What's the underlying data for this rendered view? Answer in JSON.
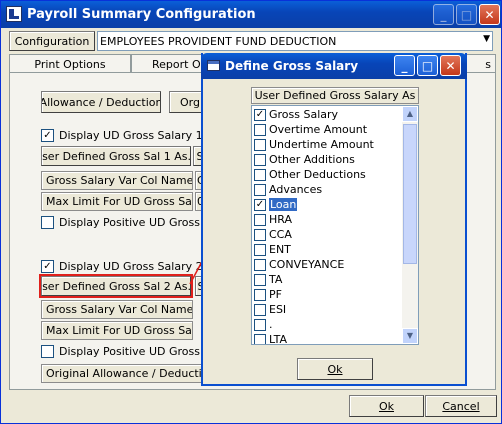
{
  "main_window": {
    "title": "Payroll Summary Configuration",
    "config_label": "Configuration",
    "config_value": "EMPLOYEES PROVIDENT FUND DEDUCTION",
    "tabs": [
      "Print Options",
      "Report Op",
      "s"
    ],
    "allowance_button": "Allowance / Deduction",
    "org_button": "Org /",
    "section1": {
      "display_label": "Display UD Gross Salary 1",
      "display_checked": true,
      "ud_button": "User Defined Gross Sal 1 As...",
      "ud_side": "S",
      "var_col_label": "Gross Salary Var Col Name As",
      "var_col_side": "G",
      "max_limit_label": "Max Limit For UD Gross Salary",
      "max_limit_side": "0",
      "positive_label": "Display Positive UD Gross Sala",
      "positive_checked": false
    },
    "section2": {
      "display_label": "Display UD Gross Salary 2",
      "display_checked": true,
      "ud_button": "User Defined Gross Sal 2 As...",
      "ud_side": "S",
      "var_col_label": "Gross Salary Var Col Name As",
      "max_limit_label": "Max Limit For UD Gross Salary",
      "positive_label": "Display Positive UD Gross Sala",
      "positive_checked": false,
      "original_label": "Original Allowance / Deduction F"
    },
    "ok_button": "Ok",
    "cancel_button": "Cancel",
    "highlight_color": "#e0201b"
  },
  "dialog": {
    "title": "Define Gross Salary",
    "header": "User Defined Gross Salary As",
    "items": [
      {
        "label": "Gross Salary",
        "checked": true,
        "selected": false
      },
      {
        "label": "Overtime Amount",
        "checked": false,
        "selected": false
      },
      {
        "label": "Undertime Amount",
        "checked": false,
        "selected": false
      },
      {
        "label": "Other Additions",
        "checked": false,
        "selected": false
      },
      {
        "label": "Other Deductions",
        "checked": false,
        "selected": false
      },
      {
        "label": "Advances",
        "checked": false,
        "selected": false
      },
      {
        "label": "Loan",
        "checked": true,
        "selected": true
      },
      {
        "label": "HRA",
        "checked": false,
        "selected": false
      },
      {
        "label": "CCA",
        "checked": false,
        "selected": false
      },
      {
        "label": "ENT",
        "checked": false,
        "selected": false
      },
      {
        "label": "CONVEYANCE",
        "checked": false,
        "selected": false
      },
      {
        "label": "TA",
        "checked": false,
        "selected": false
      },
      {
        "label": "PF",
        "checked": false,
        "selected": false
      },
      {
        "label": "ESI",
        "checked": false,
        "selected": false
      },
      {
        "label": ".",
        "checked": false,
        "selected": false
      },
      {
        "label": "LTA",
        "checked": false,
        "selected": false
      }
    ],
    "ok_button": "Ok"
  },
  "icons": {
    "app": "app-icon",
    "dialog": "dialog-icon",
    "minimize": "minimize-icon",
    "maximize": "maximize-icon",
    "close": "close-icon",
    "dropdown": "chevron-down-icon"
  }
}
